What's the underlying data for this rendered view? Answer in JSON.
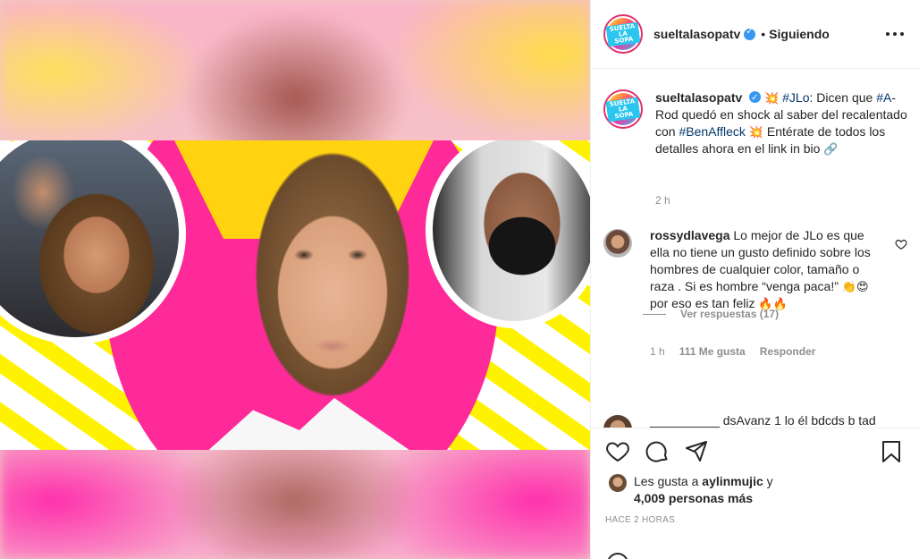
{
  "header": {
    "username": "sueltalasopatv",
    "separator": "•",
    "follow_status": "Siguiendo",
    "avatar_logo": "SUELTA LA SOPA"
  },
  "caption": {
    "username": "sueltalasopatv",
    "emoji_start": "💥",
    "tag_jlo": "#JLo",
    "text_1": ": Dicen que",
    "tag_arod": "#A",
    "text_2": "-Rod quedó en shock al saber del recalentado con",
    "tag_ben": "#BenAffleck",
    "emoji_mid": "💥",
    "text_3": "Entérate de todos los detalles ahora en el link in bio",
    "emoji_end": "🔗",
    "time": "2 h"
  },
  "comment": {
    "username": "rossydlavega",
    "text": "Lo mejor de JLo es que ella no tiene un gusto definido sobre los hombres de cualquier color, tamaño o raza . Si es hombre “venga paca!”",
    "emoji_a": "👏😍",
    "text_2": "por eso es tan feliz",
    "emoji_b": "🔥🔥",
    "time": "1 h",
    "likes": "111 Me gusta",
    "reply": "Responder",
    "view_replies": "Ver respuestas (17)"
  },
  "next_comment": {
    "text": "__________ dsAvanz 1 lo él bdcds b tad"
  },
  "likes": {
    "prefix": "Les gusta a",
    "user": "aylinmujic",
    "conj": "y",
    "count": "4,009 personas más"
  },
  "timestamp": "HACE 2 HORAS",
  "icons": {
    "like": "heart-icon",
    "comment": "comment-bubble-icon",
    "share": "paper-plane-icon",
    "save": "bookmark-icon",
    "more": "more-options-icon",
    "verified": "verified-badge-icon",
    "emoji": "emoji-icon"
  },
  "colors": {
    "link": "#00376b",
    "verified": "#3897f0",
    "meta_gray": "#8e8e8e",
    "thumb_pink": "#ff2a9a",
    "thumb_yellow": "#fff200"
  }
}
